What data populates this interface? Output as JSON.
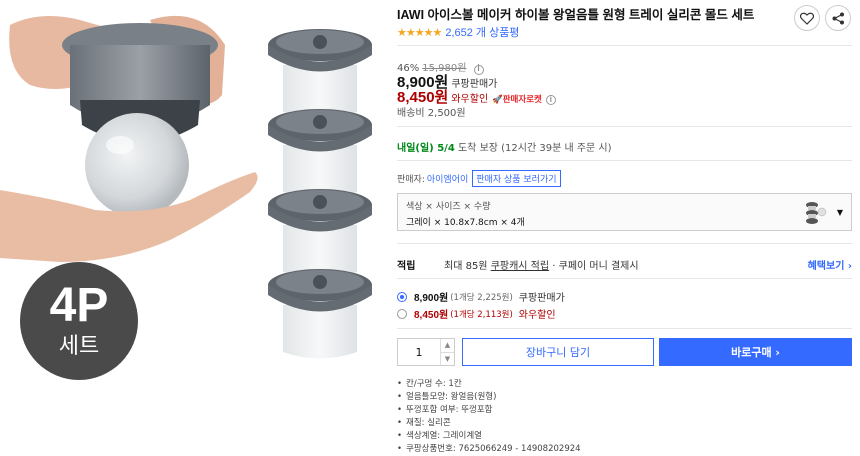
{
  "gallery": {
    "badge_big": "4P",
    "badge_small": "세트"
  },
  "product": {
    "title": "IAWI 아이스볼 메이커 하이볼 왕얼음틀 원형 트레이 실리콘 몰드 세트",
    "rating_stars": "★★★★★",
    "rating_value": 4.5,
    "review_count": "2,652 개 상품평"
  },
  "price": {
    "discount_rate": "46%",
    "original": "15,980원",
    "coupang_price": "8,900원",
    "coupang_label": "쿠팡판매가",
    "wow_price": "8,450원",
    "wow_label": "와우할인",
    "rocket_label": "🚀판매자로켓",
    "shipping": "배송비 2,500원"
  },
  "delivery": {
    "when": "내일(일) 5/4",
    "rest": "도착 보장 (12시간 39분 내 주문 시)"
  },
  "seller": {
    "label": "판매자:",
    "name": "아이엠어이",
    "link": "판매자 상품 보러가기"
  },
  "option": {
    "labels": "색상 × 사이즈 × 수량",
    "values": "그레이 × 10.8x7.8cm × 4개"
  },
  "reward": {
    "label": "적립",
    "text_a": "최대 85원 ",
    "text_b": "쿠팡캐시 적립",
    "text_c": " · 쿠페이 머니 결제시",
    "more": "혜택보기 ›"
  },
  "purchase_options": [
    {
      "price": "8,900원",
      "unit": "(1개당 2,225원)",
      "tag": "쿠팡판매가",
      "selected": true
    },
    {
      "price": "8,450원",
      "unit": "(1개당 2,113원)",
      "tag": "와우할인",
      "selected": false
    }
  ],
  "actions": {
    "quantity": "1",
    "cart": "장바구니 담기",
    "buy": "바로구매 ›"
  },
  "specs": [
    "칸/구멍 수: 1칸",
    "얼음틀모양: 왕얼음(원형)",
    "뚜껑포함 여부: 뚜껑포함",
    "재질: 실리콘",
    "색상계열: 그레이계열",
    "쿠팡상품번호: 7625066249 - 14908202924"
  ],
  "colors": {
    "accent": "#346aff",
    "sale_red": "#ae0000",
    "star": "#f5a623",
    "delivery_green": "#00891a"
  }
}
